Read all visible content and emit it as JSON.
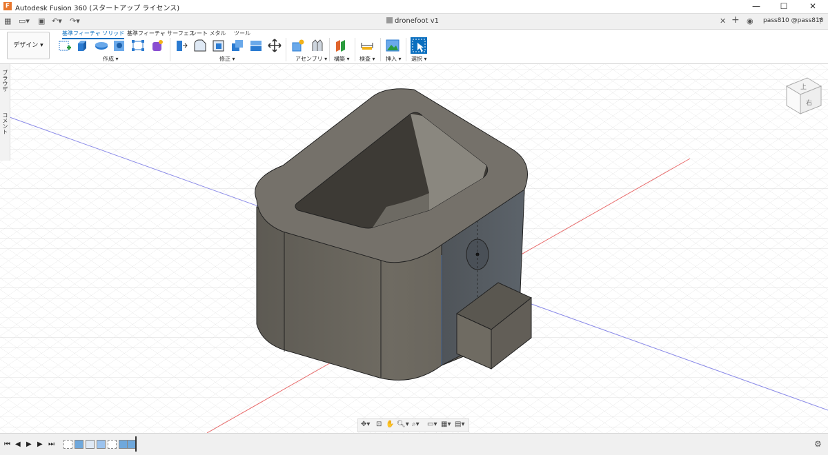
{
  "window": {
    "title": "Autodesk Fusion 360 (スタートアップ ライセンス)",
    "app_icon_letter": "F",
    "minimize": "—",
    "maximize": "☐",
    "close": "✕"
  },
  "tabbar": {
    "document_title": "dronefoot v1",
    "close_tab": "✕",
    "new_tab": "+",
    "user": "pass810 @pass810",
    "icons": [
      "grid-icon",
      "file-icon",
      "save-icon",
      "undo-icon",
      "redo-icon"
    ]
  },
  "ribbon": {
    "workspace": "デザイン ▾",
    "tabs": [
      {
        "label": "基準フィーチャ ソリッド",
        "active": true
      },
      {
        "label": "基準フィーチャ サーフェス",
        "active": false
      },
      {
        "label": "シート メタル",
        "active": false
      },
      {
        "label": "ツール",
        "active": false
      }
    ],
    "groups": [
      "作成 ▾",
      "修正 ▾",
      "アセンブリ ▾",
      "構築 ▾",
      "検査 ▾",
      "挿入 ▾",
      "選択 ▾"
    ],
    "colors": {
      "accent": "#0b6fbf",
      "tool_blue": "#2b7bd1"
    }
  },
  "sidepanel": {
    "browser": "ブラウザ",
    "comments": "コメント"
  },
  "viewcube": {
    "top": "上",
    "right": "右"
  },
  "navbar": {
    "icons": [
      "orbit-icon",
      "look-at-icon",
      "pan-icon",
      "zoom-icon",
      "fit-icon",
      "display-icon",
      "grid-icon",
      "view-icon"
    ]
  },
  "timeline": {
    "controls": [
      "⏮",
      "◀",
      "▶",
      "▶",
      "⏭"
    ],
    "feature_count": 7,
    "settings": "⚙"
  },
  "model": {
    "body_color": "#6f6b62",
    "top_color": "#75716a",
    "axis_x_color": "#e04b4b",
    "axis_z_color": "#5a5ae0"
  }
}
